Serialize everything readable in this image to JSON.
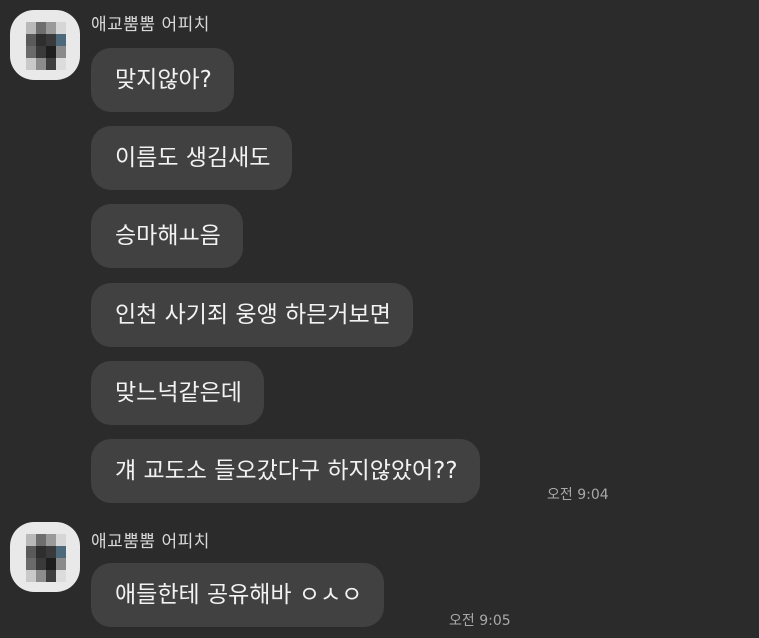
{
  "groups": [
    {
      "sender": "애교뿜뿜 어피치",
      "avatar_icon": "profile-avatar-blurred",
      "messages": [
        "맞지않아?",
        "이름도 생김새도",
        "승마해ㅛ음",
        "인천 사기죄 웅앵 하믄거보면",
        "맞느넉같은데",
        "걔 교도소 들오갔다구 하지않았어??"
      ],
      "time": "오전 9:04"
    },
    {
      "sender": "애교뿜뿜 어피치",
      "avatar_icon": "profile-avatar-blurred",
      "messages": [
        "애들한테 공유해바 ㅇㅅㅇ"
      ],
      "time": "오전 9:05"
    }
  ],
  "colors": {
    "background": "#2b2b2b",
    "bubble": "#414141",
    "text": "#f2f2f2",
    "sender": "#d9d9d9",
    "time": "#a8a8a8"
  }
}
